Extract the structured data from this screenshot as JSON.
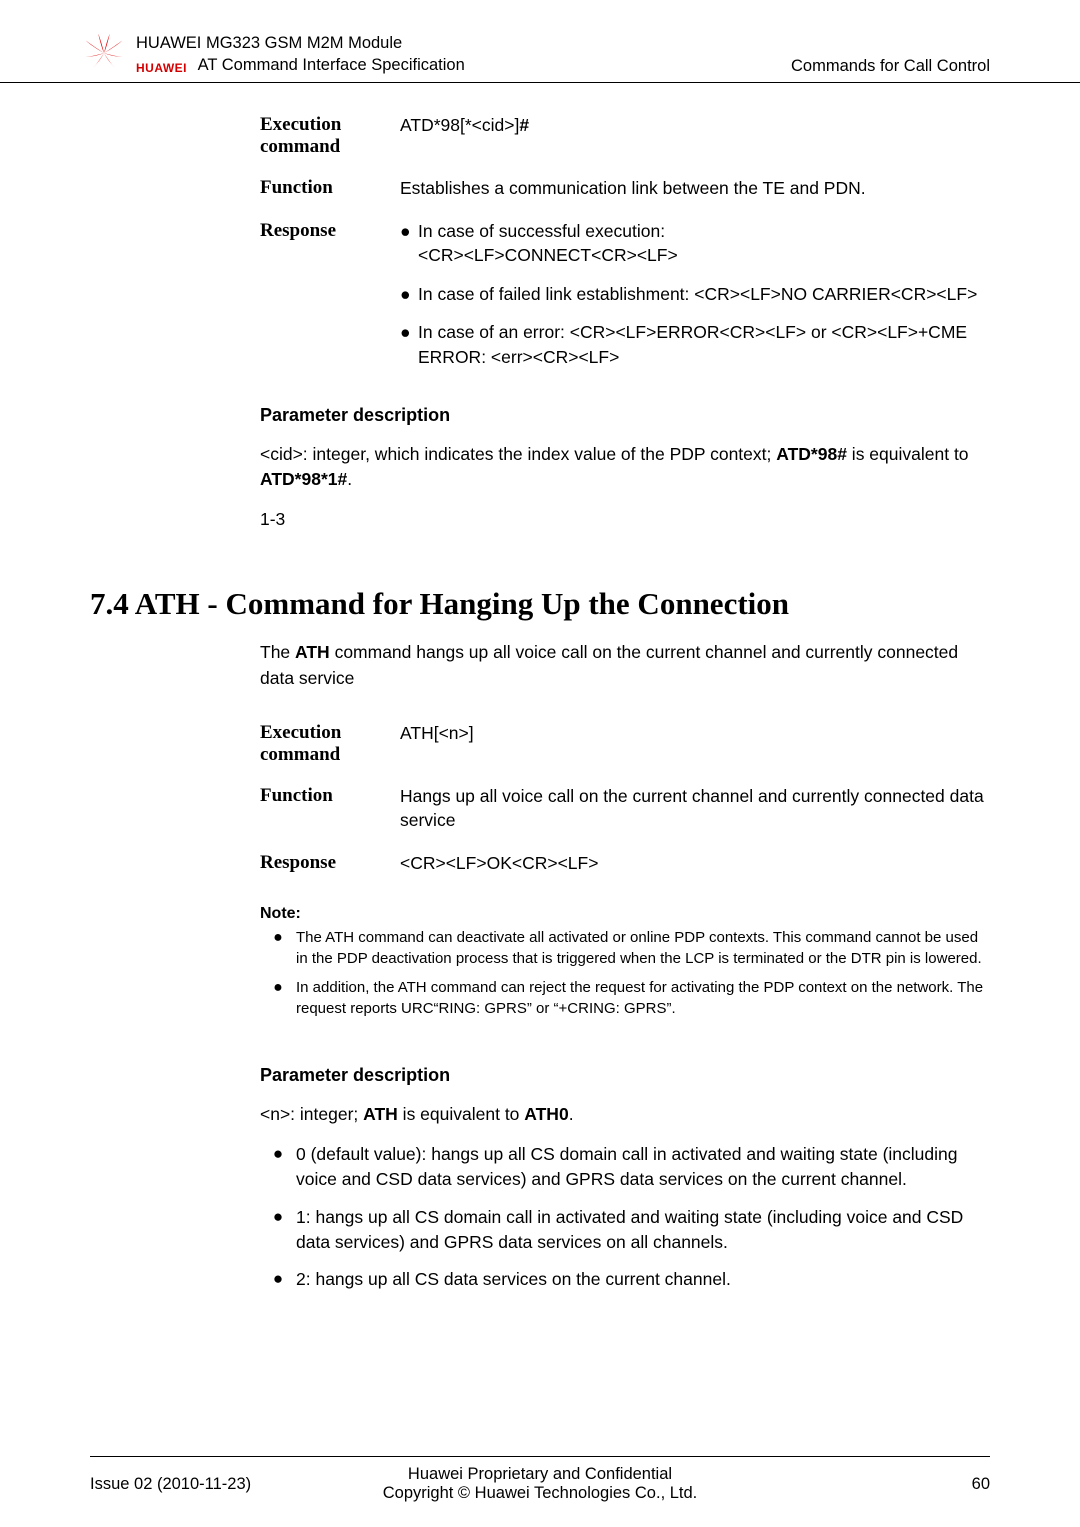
{
  "header": {
    "line1": "HUAWEI MG323 GSM M2M Module",
    "line2": "AT Command Interface Specification",
    "right": "Commands for Call Control",
    "brand": "HUAWEI"
  },
  "block1": {
    "exec_label": "Execution command",
    "exec_value": "ATD*98[*<cid>]#",
    "func_label": "Function",
    "func_value": "Establishes a communication link between the TE and PDN.",
    "resp_label": "Response",
    "resp_b1_l1": "In case of successful execution: <CR><LF>CONNECT<CR><LF>",
    "resp_b2": "In case of failed link establishment: <CR><LF>NO CARRIER<CR><LF>",
    "resp_b3": "In case of an error: <CR><LF>ERROR<CR><LF> or <CR><LF>+CME ERROR: <err><CR><LF>"
  },
  "param1": {
    "heading": "Parameter description",
    "text_pre": "<cid>: integer, which indicates the index value of the PDP context; ",
    "text_bold1": "ATD*98#",
    "text_mid": " is equivalent to ",
    "text_bold2": "ATD*98*1#",
    "text_post": ".",
    "range": "1-3"
  },
  "section": {
    "title": "7.4 ATH - Command for Hanging Up the Connection",
    "intro_pre": "The ",
    "intro_bold": "ATH",
    "intro_post": " command hangs up all voice call on the current channel and currently connected data service"
  },
  "block2": {
    "exec_label": "Execution command",
    "exec_value": "ATH[<n>]",
    "func_label": "Function",
    "func_value": "Hangs up all voice call on the current channel and currently connected data service",
    "resp_label": "Response",
    "resp_value": "<CR><LF>OK<CR><LF>"
  },
  "notes": {
    "label": "Note:",
    "n1": "The ATH command can deactivate all activated or online PDP contexts. This command cannot be used in the PDP deactivation process that is triggered when the LCP is terminated or the DTR pin is lowered.",
    "n2": "In addition, the ATH command can reject the request for activating the PDP context on the network. The request reports URC“RING: GPRS” or “+CRING: GPRS”."
  },
  "param2": {
    "heading": "Parameter description",
    "line_pre": "<n>: integer; ",
    "line_b1": "ATH",
    "line_mid": " is equivalent to ",
    "line_b2": "ATH0",
    "line_post": ".",
    "b0": "0 (default value): hangs up all CS domain call in activated and waiting state (including voice and CSD data services) and GPRS data services on the current channel.",
    "b1": "1: hangs up all CS domain call in activated and waiting state (including voice and CSD data services) and GPRS data services on all channels.",
    "b2": "2: hangs up all CS data services on the current channel."
  },
  "footer": {
    "left": "Issue 02 (2010-11-23)",
    "center1": "Huawei Proprietary and Confidential",
    "center2": "Copyright © Huawei Technologies Co., Ltd.",
    "right": "60"
  }
}
